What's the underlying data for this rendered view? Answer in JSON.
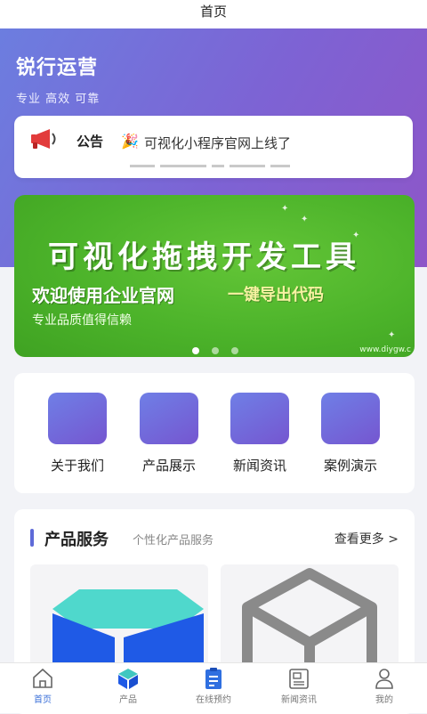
{
  "page_title": "首页",
  "brand": {
    "name": "锐行运营",
    "slogan": "专业 高效 可靠"
  },
  "notice": {
    "label": "公告",
    "text": "可视化小程序官网上线了"
  },
  "banner": {
    "title": "可视化拖拽开发工具",
    "subtitle_left": "欢迎使用企业官网",
    "subtitle_right": "一键导出代码",
    "line": "专业品质值得信赖",
    "url": "www.diygw.c",
    "slide_count": 3,
    "active_slide": 1
  },
  "menu": {
    "items": [
      {
        "label": "关于我们"
      },
      {
        "label": "产品展示"
      },
      {
        "label": "新闻资讯"
      },
      {
        "label": "案例演示"
      }
    ]
  },
  "services": {
    "title": "产品服务",
    "subtitle": "个性化产品服务",
    "more": "查看更多 >"
  },
  "tabbar": {
    "items": [
      {
        "label": "首页",
        "icon": "home-icon",
        "active": true
      },
      {
        "label": "产品",
        "icon": "cube-icon",
        "active": false
      },
      {
        "label": "在线预约",
        "icon": "clipboard-icon",
        "active": false
      },
      {
        "label": "新闻资讯",
        "icon": "newspaper-icon",
        "active": false
      },
      {
        "label": "我的",
        "icon": "user-icon",
        "active": false
      }
    ]
  },
  "colors": {
    "header_gradient_start": "#6b7fe0",
    "header_gradient_end": "#8e56c8",
    "banner_green": "#4cb32a",
    "menu_icon_start": "#6f7fe6",
    "menu_icon_end": "#7556d0",
    "tab_active": "#3a6fd8"
  }
}
